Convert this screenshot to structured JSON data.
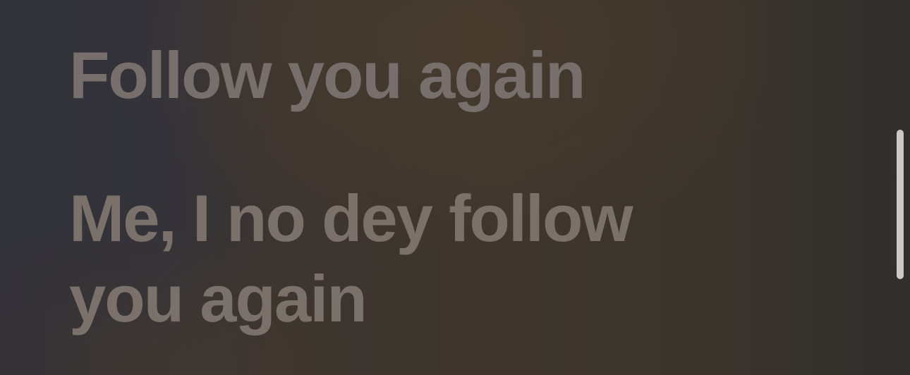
{
  "lyrics": {
    "lines": [
      {
        "text": "Follow you again"
      },
      {
        "text": "Me, I no dey follow you again"
      }
    ]
  },
  "colors": {
    "lyric_text": "#7a716a",
    "scrollbar": "#d9d6d2",
    "background_left": "#34343a",
    "background_right": "#302f2d"
  }
}
